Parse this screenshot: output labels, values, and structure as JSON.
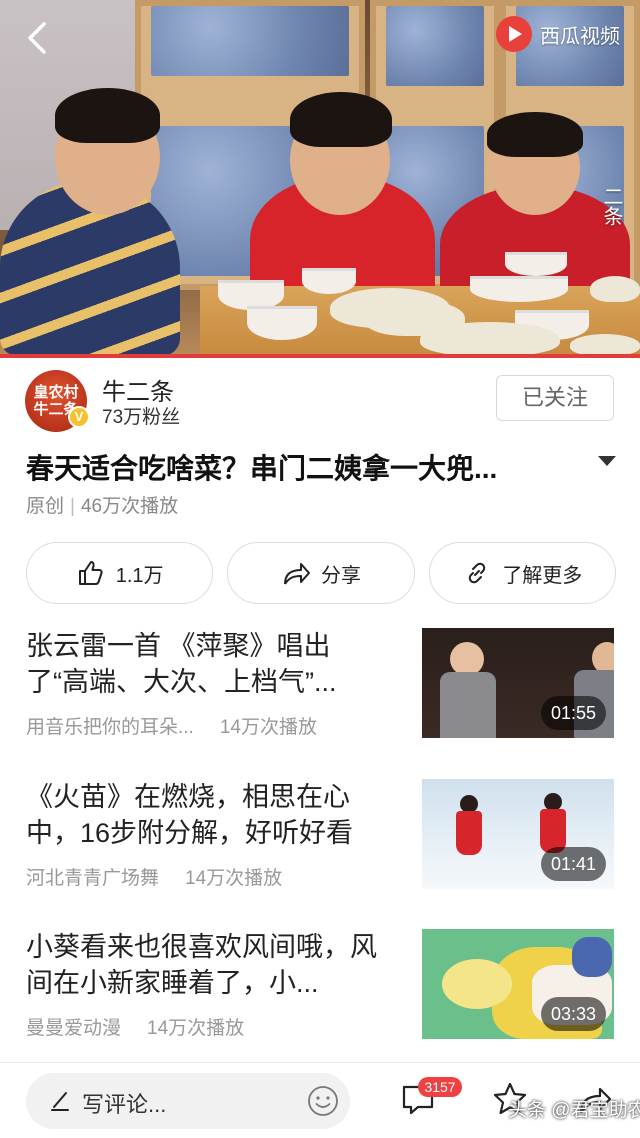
{
  "video": {
    "logo_text": "西瓜视频",
    "side_text": "二条",
    "progress": 1.0
  },
  "author": {
    "avatar_text": "皇农村 牛二条",
    "name": "牛二条",
    "fans": "73万粉丝",
    "follow_label": "已关注"
  },
  "post": {
    "title": "春天适合吃啥菜？串门二姨拿一大兜...",
    "source": "原创",
    "plays": "46万次播放"
  },
  "actions": {
    "like": "1.1万",
    "share": "分享",
    "more": "了解更多"
  },
  "recommended": [
    {
      "title": "张云雷一首 《萍聚》唱出了“高端、大次、上档气”...",
      "author": "用音乐把你的耳朵...",
      "plays": "14万次播放",
      "duration": "01:55"
    },
    {
      "title": "《火苗》在燃烧，相思在心中，16步附分解，好听好看",
      "author": "河北青青广场舞",
      "plays": "14万次播放",
      "duration": "01:41"
    },
    {
      "title": "小葵看来也很喜欢风间哦，风间在小新家睡着了，小...",
      "author": "曼曼爱动漫",
      "plays": "14万次播放",
      "duration": "03:33"
    }
  ],
  "bottom": {
    "comment_placeholder": "写评论...",
    "comment_count": "3157",
    "watermark": "头条 @君宝助农"
  },
  "colors": {
    "accent": "#e23b3b",
    "badge": "#f04142",
    "verified": "#f5c22b"
  }
}
